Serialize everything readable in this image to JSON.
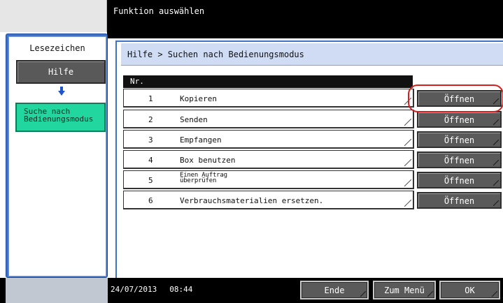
{
  "header": {
    "title": "Funktion auswählen"
  },
  "sidebar": {
    "tab_label": "Lesezeichen",
    "hilfe_label": "Hilfe",
    "suche_label_line1": "Suche nach",
    "suche_label_line2": "Bedienungsmodus"
  },
  "breadcrumb": "Hilfe > Suchen nach Bedienungsmodus",
  "table": {
    "header": "Nr.",
    "open_label": "Öffnen",
    "rows": [
      {
        "nr": "1",
        "name": "Kopieren"
      },
      {
        "nr": "2",
        "name": "Senden"
      },
      {
        "nr": "3",
        "name": "Empfangen"
      },
      {
        "nr": "4",
        "name": "Box benutzen"
      },
      {
        "nr": "5",
        "name_line1": "Einen Auftrag",
        "name_line2": "überprüfen"
      },
      {
        "nr": "6",
        "name": "Verbrauchsmaterialien ersetzen."
      }
    ]
  },
  "footer": {
    "date": "24/07/2013",
    "time": "08:44",
    "ende_label": "Ende",
    "menu_label": "Zum Menü",
    "ok_label": "OK"
  },
  "colors": {
    "accent_blue": "#3f73c8",
    "active_green": "#22d69f",
    "highlight_red": "#d42020"
  }
}
